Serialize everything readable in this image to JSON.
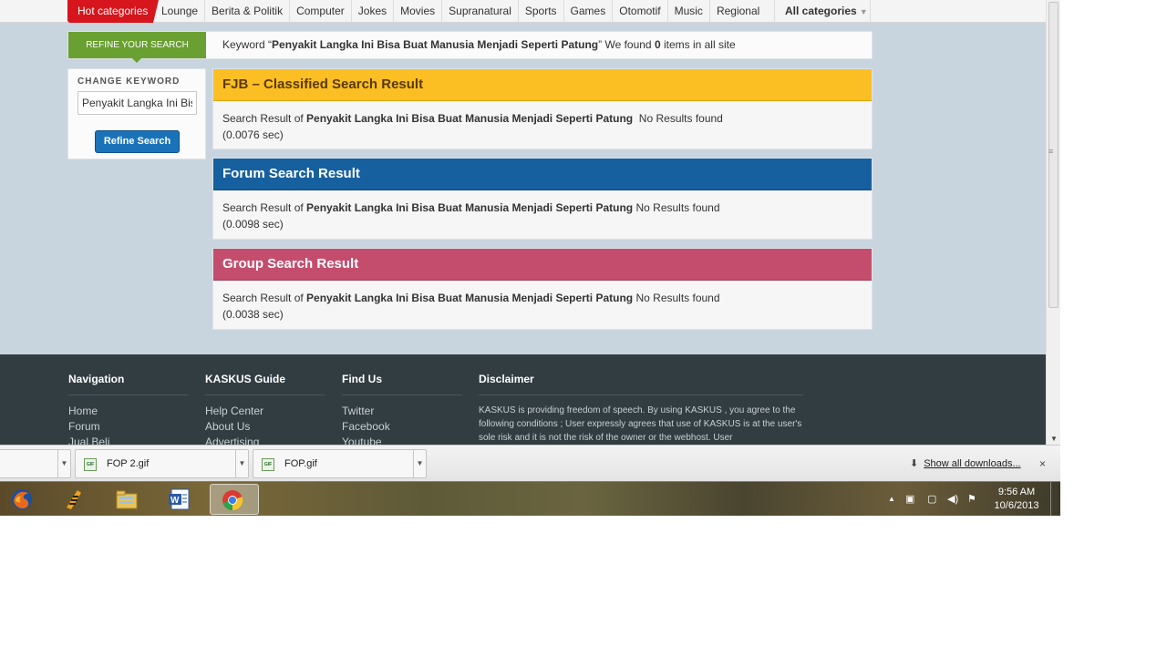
{
  "topnav": {
    "hot": "Hot categories",
    "items": [
      "Lounge",
      "Berita & Politik",
      "Computer",
      "Jokes",
      "Movies",
      "Supranatural",
      "Sports",
      "Games",
      "Otomotif",
      "Music",
      "Regional"
    ],
    "all": "All categories"
  },
  "refine": {
    "label": "REFINE YOUR SEARCH",
    "kw_prefix": "Keyword “",
    "keyword": "Penyakit Langka Ini Bisa Buat Manusia Menjadi Seperti Patung",
    "kw_mid": "” We found ",
    "count": "0",
    "kw_suffix": " items in all site"
  },
  "sidebar": {
    "label": "CHANGE KEYWORD",
    "input_value": "Penyakit Langka Ini Bisa Buat Manusia Menjadi Seperti Patung",
    "button": "Refine Search"
  },
  "results": [
    {
      "title": "FJB – Classified Search Result",
      "prefix": "Search Result of ",
      "keyword": "Penyakit Langka Ini Bisa Buat Manusia Menjadi Seperti Patung",
      "status": "  No Results found",
      "time": "(0.0076 sec)",
      "color": "#fbbf23"
    },
    {
      "title": "Forum Search Result",
      "prefix": "Search Result of ",
      "keyword": "Penyakit Langka Ini Bisa Buat Manusia Menjadi Seperti Patung",
      "status": " No Results found",
      "time": "(0.0098 sec)",
      "color": "#17609f"
    },
    {
      "title": "Group Search Result",
      "prefix": "Search Result of ",
      "keyword": "Penyakit Langka Ini Bisa Buat Manusia Menjadi Seperti Patung",
      "status": " No Results found",
      "time": "(0.0038 sec)",
      "color": "#c44d6e"
    }
  ],
  "footer": {
    "navigation": {
      "title": "Navigation",
      "links": [
        "Home",
        "Forum",
        "Jual Beli"
      ]
    },
    "guide": {
      "title": "KASKUS Guide",
      "links": [
        "Help Center",
        "About Us",
        "Advertising"
      ]
    },
    "findus": {
      "title": "Find Us",
      "links": [
        "Twitter",
        "Facebook",
        "Youtube"
      ]
    },
    "disclaimer": {
      "title": "Disclaimer",
      "text": "KASKUS is providing freedom of speech. By using KASKUS , you agree to the following conditions ; User expressly agrees that use of KASKUS is at the user's sole risk and it is not the risk of the owner or the webhost. User"
    }
  },
  "downloads": {
    "items": [
      "FOP 2.gif",
      "FOP.gif"
    ],
    "show_all": "Show all downloads...",
    "close": "×"
  },
  "taskbar": {
    "apps": [
      "firefox-icon",
      "winamp-icon",
      "explorer-icon",
      "word-icon",
      "chrome-icon"
    ],
    "time": "9:56 AM",
    "date": "10/6/2013"
  }
}
